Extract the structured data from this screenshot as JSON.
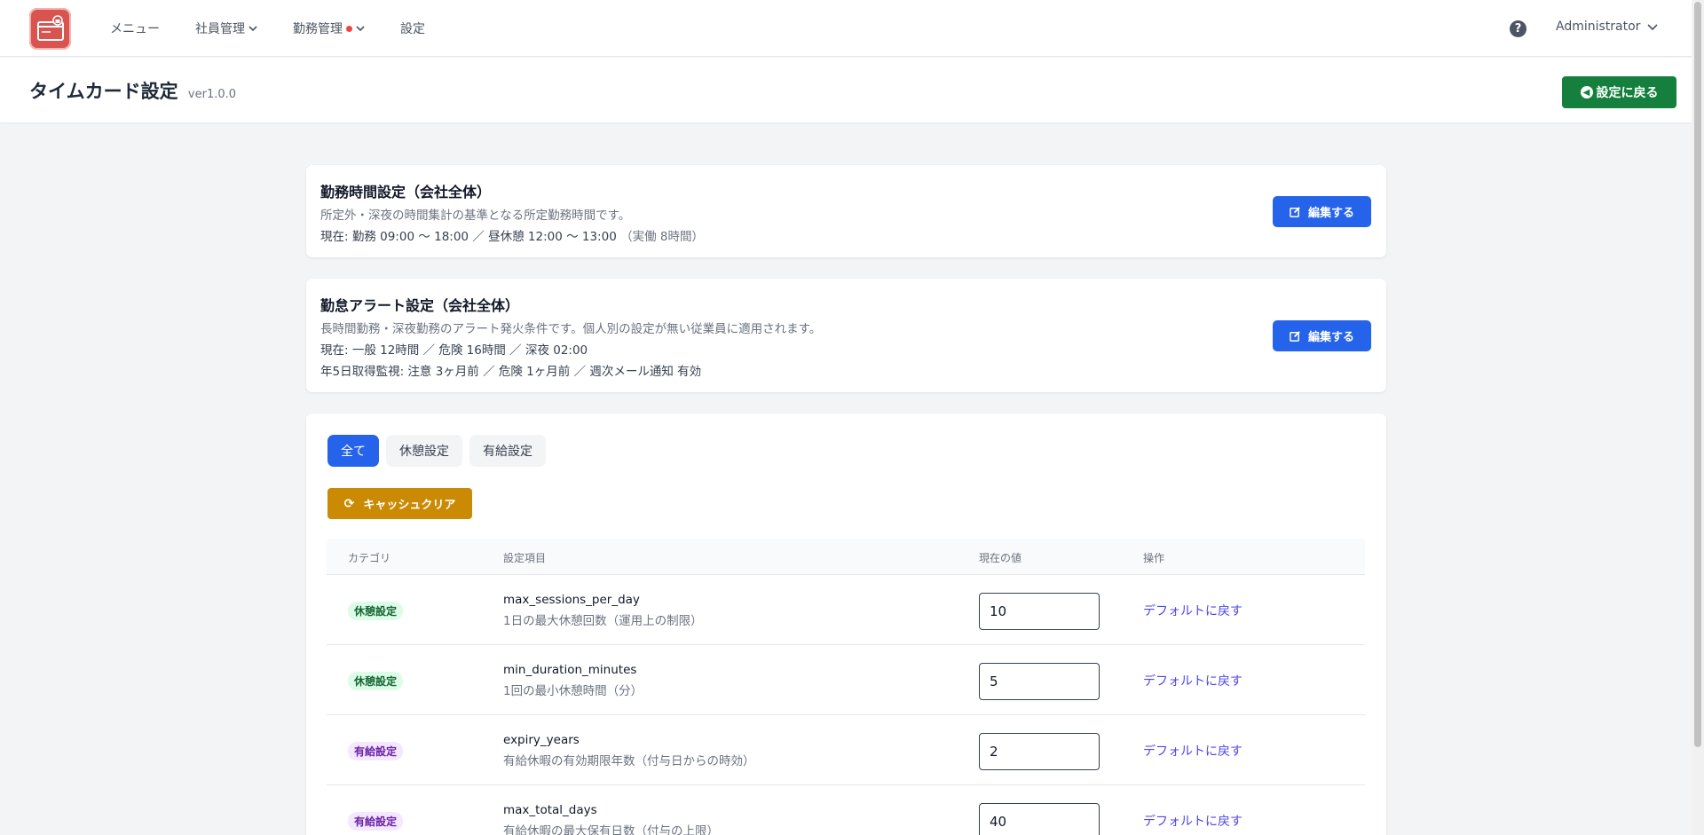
{
  "nav": {
    "items": [
      {
        "label": "メニュー"
      },
      {
        "label": "社員管理"
      },
      {
        "label": "勤務管理"
      },
      {
        "label": "設定"
      }
    ],
    "user": "Administrator"
  },
  "header": {
    "title": "タイムカード設定",
    "version": "ver1.0.0",
    "back_label": "設定に戻る"
  },
  "work_hours": {
    "title": "勤務時間設定（会社全体）",
    "description": "所定外・深夜の時間集計の基準となる所定勤務時間です。",
    "current": "現在: 勤務 09:00 〜 18:00 ／ 昼休憩 12:00 〜 13:00",
    "current_sub": "（実働 8時間）",
    "edit_label": "編集する"
  },
  "alert": {
    "title": "勤怠アラート設定（会社全体）",
    "description": "長時間勤務・深夜勤務のアラート発火条件です。個人別の設定が無い従業員に適用されます。",
    "current": "現在: 一般 12時間 ／ 危険 16時間 ／ 深夜 02:00",
    "leave_monitor": "年5日取得監視: 注意 3ヶ月前 ／ 危険 1ヶ月前 ／ 週次メール通知 有効",
    "edit_label": "編集する"
  },
  "settings": {
    "tabs": [
      "全て",
      "休憩設定",
      "有給設定"
    ],
    "cache_clear_label": "キャッシュクリア",
    "columns": [
      "カテゴリ",
      "設定項目",
      "現在の値",
      "操作"
    ],
    "rows": [
      {
        "category": "休憩設定",
        "key": "max_sessions_per_day",
        "desc": "1日の最大休憩回数（運用上の制限）",
        "value": "10",
        "action": "デフォルトに戻す"
      },
      {
        "category": "休憩設定",
        "key": "min_duration_minutes",
        "desc": "1回の最小休憩時間（分）",
        "value": "5",
        "action": "デフォルトに戻す"
      },
      {
        "category": "有給設定",
        "key": "expiry_years",
        "desc": "有給休暇の有効期限年数（付与日からの時効）",
        "value": "2",
        "action": "デフォルトに戻す"
      },
      {
        "category": "有給設定",
        "key": "max_total_days",
        "desc": "有給休暇の最大保有日数（付与の上限）",
        "value": "40",
        "action": "デフォルトに戻す"
      }
    ]
  },
  "colors": {
    "primary": "#2563eb",
    "success": "#15803d",
    "warning": "#ca8a04",
    "logo": "#d9534f"
  }
}
